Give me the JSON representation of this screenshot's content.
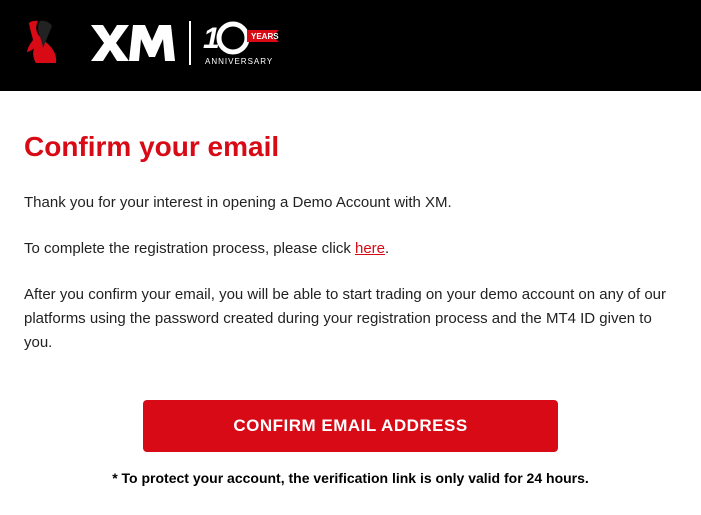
{
  "header": {
    "brand": "XM",
    "anniversary_number": "10",
    "anniversary_years_label": "YEARS",
    "anniversary_sub": "ANNIVERSARY"
  },
  "content": {
    "heading": "Confirm your email",
    "p1": "Thank you for your interest in opening a Demo Account with XM.",
    "p2_prefix": "To complete the registration process, please click ",
    "p2_link": "here",
    "p2_suffix": ".",
    "p3": "After you confirm your email, you will be able to start trading on your demo account on any of our platforms using the password created during your registration process and the MT4 ID given to you.",
    "button_label": "CONFIRM EMAIL ADDRESS",
    "disclaimer": "* To protect your account, the verification link is only valid for 24 hours."
  },
  "colors": {
    "brand_red": "#d70a16",
    "header_bg": "#000000"
  }
}
